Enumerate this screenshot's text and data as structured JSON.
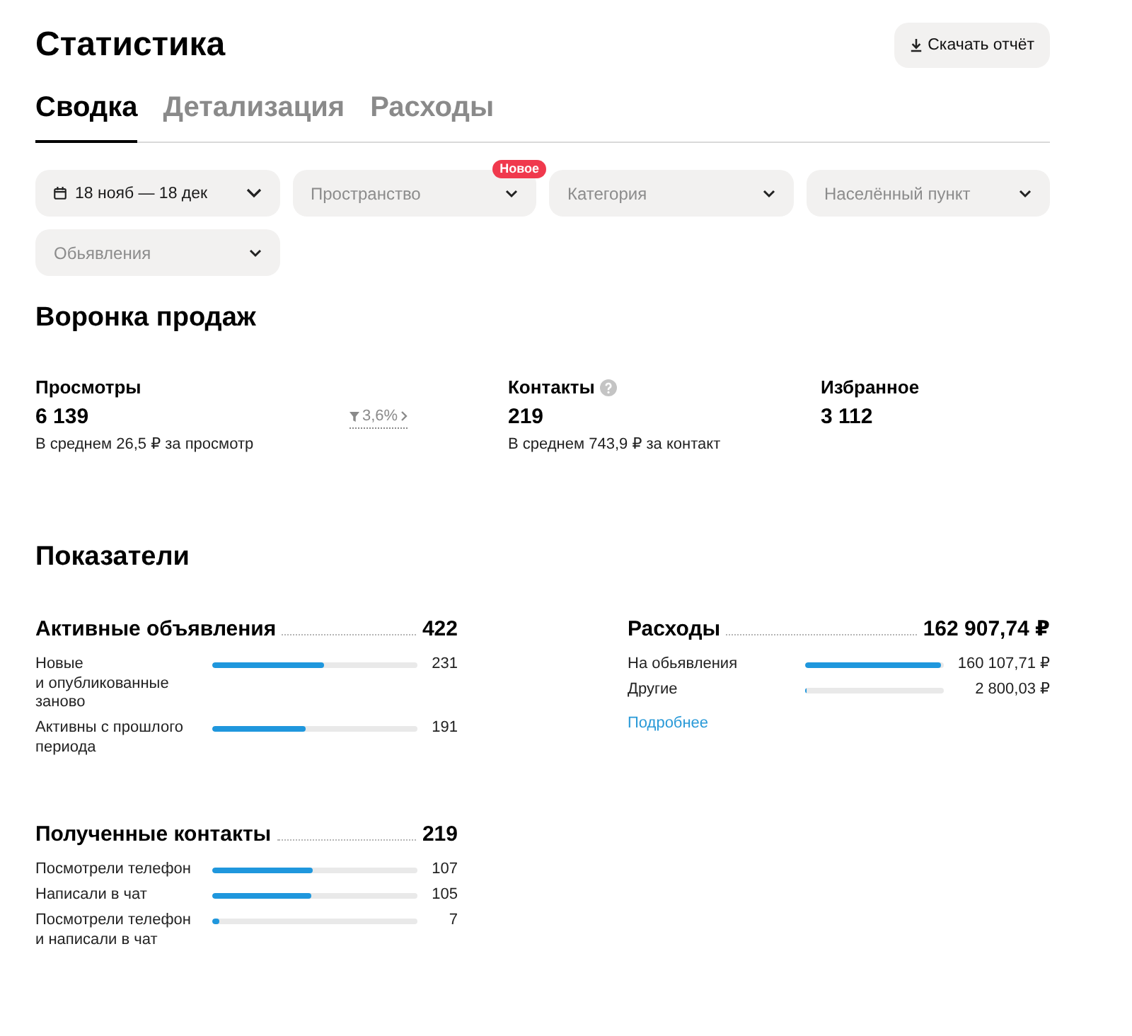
{
  "header": {
    "title": "Статистика",
    "download_button": {
      "label": "Скачать отчёт"
    }
  },
  "tabs": [
    {
      "label": "Сводка",
      "selected": true
    },
    {
      "label": "Детализация",
      "selected": false
    },
    {
      "label": "Расходы",
      "selected": false
    }
  ],
  "filters": [
    {
      "kind": "date",
      "value": "18 нояб — 18 дек"
    },
    {
      "kind": "select",
      "placeholder": "Пространство",
      "badge": "Новое"
    },
    {
      "kind": "select",
      "placeholder": "Категория"
    },
    {
      "kind": "select",
      "placeholder": "Населённый пункт"
    },
    {
      "kind": "select",
      "placeholder": "Обьявления"
    }
  ],
  "funnel": {
    "title": "Воронка продаж",
    "metrics": [
      {
        "label": "Просмотры",
        "value": "6 139",
        "note": "В среднем 26,5 ₽ за просмотр",
        "conversion": "3,6%"
      },
      {
        "label": "Контакты",
        "help_icon": true,
        "value": "219",
        "note": "В среднем 743,9 ₽ за контакт"
      },
      {
        "label": "Избранное",
        "value": "3 112"
      }
    ]
  },
  "indicators": {
    "title": "Показатели",
    "columns": [
      [
        {
          "title": "Активные объявления",
          "total": "422",
          "rows": [
            {
              "label": "Новые и опубликованные заново",
              "level": 0.547,
              "value": "231"
            },
            {
              "label": "Активны с прошлого периода",
              "level": 0.453,
              "value": "191"
            }
          ]
        },
        {
          "title": "Полученные контакты",
          "total": "219",
          "rows": [
            {
              "label": "Посмотрели телефон",
              "level": 0.489,
              "value": "107"
            },
            {
              "label": "Написали в чат",
              "level": 0.479,
              "value": "105"
            },
            {
              "label": "Посмотрели телефон и написали в чат",
              "level": 0.032,
              "value": "7"
            }
          ]
        }
      ],
      [
        {
          "title": "Расходы",
          "total": "162 907,74 ₽",
          "rows": [
            {
              "label": "На обьявления",
              "level": 0.983,
              "value": "160 107,71 ₽"
            },
            {
              "label": "Другие",
              "level": 0.017,
              "value": "2 800,03 ₽"
            }
          ],
          "link": "Подробнее"
        }
      ]
    ]
  }
}
